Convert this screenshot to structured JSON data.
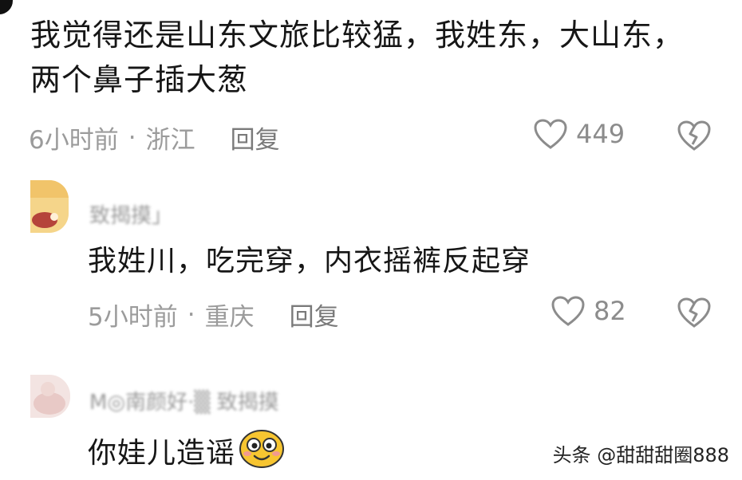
{
  "comments": [
    {
      "text_line1": "我觉得还是山东文旅比较猛，我姓东，大山东，",
      "text_line2": "两个鼻子插大葱",
      "time": "6小时前",
      "location": "浙江",
      "reply_label": "回复",
      "likes": "449"
    },
    {
      "username": "致揭摸」",
      "text": "我姓川，吃完穿，内衣摇裤反起穿",
      "time": "5小时前",
      "location": "重庆",
      "reply_label": "回复",
      "likes": "82"
    },
    {
      "username": "M◎南颜好·▒ 致揭摸",
      "text": "你娃儿造谣"
    }
  ],
  "meta_separator": "·",
  "watermark": "头条 @甜甜甜圈888",
  "icons": {
    "like": "heart-outline-icon",
    "dislike": "broken-heart-icon",
    "emoji": "smiling-face-emoji"
  },
  "colors": {
    "text": "#161616",
    "meta": "#9b9b9b",
    "emoji_yellow": "#f7c531"
  }
}
